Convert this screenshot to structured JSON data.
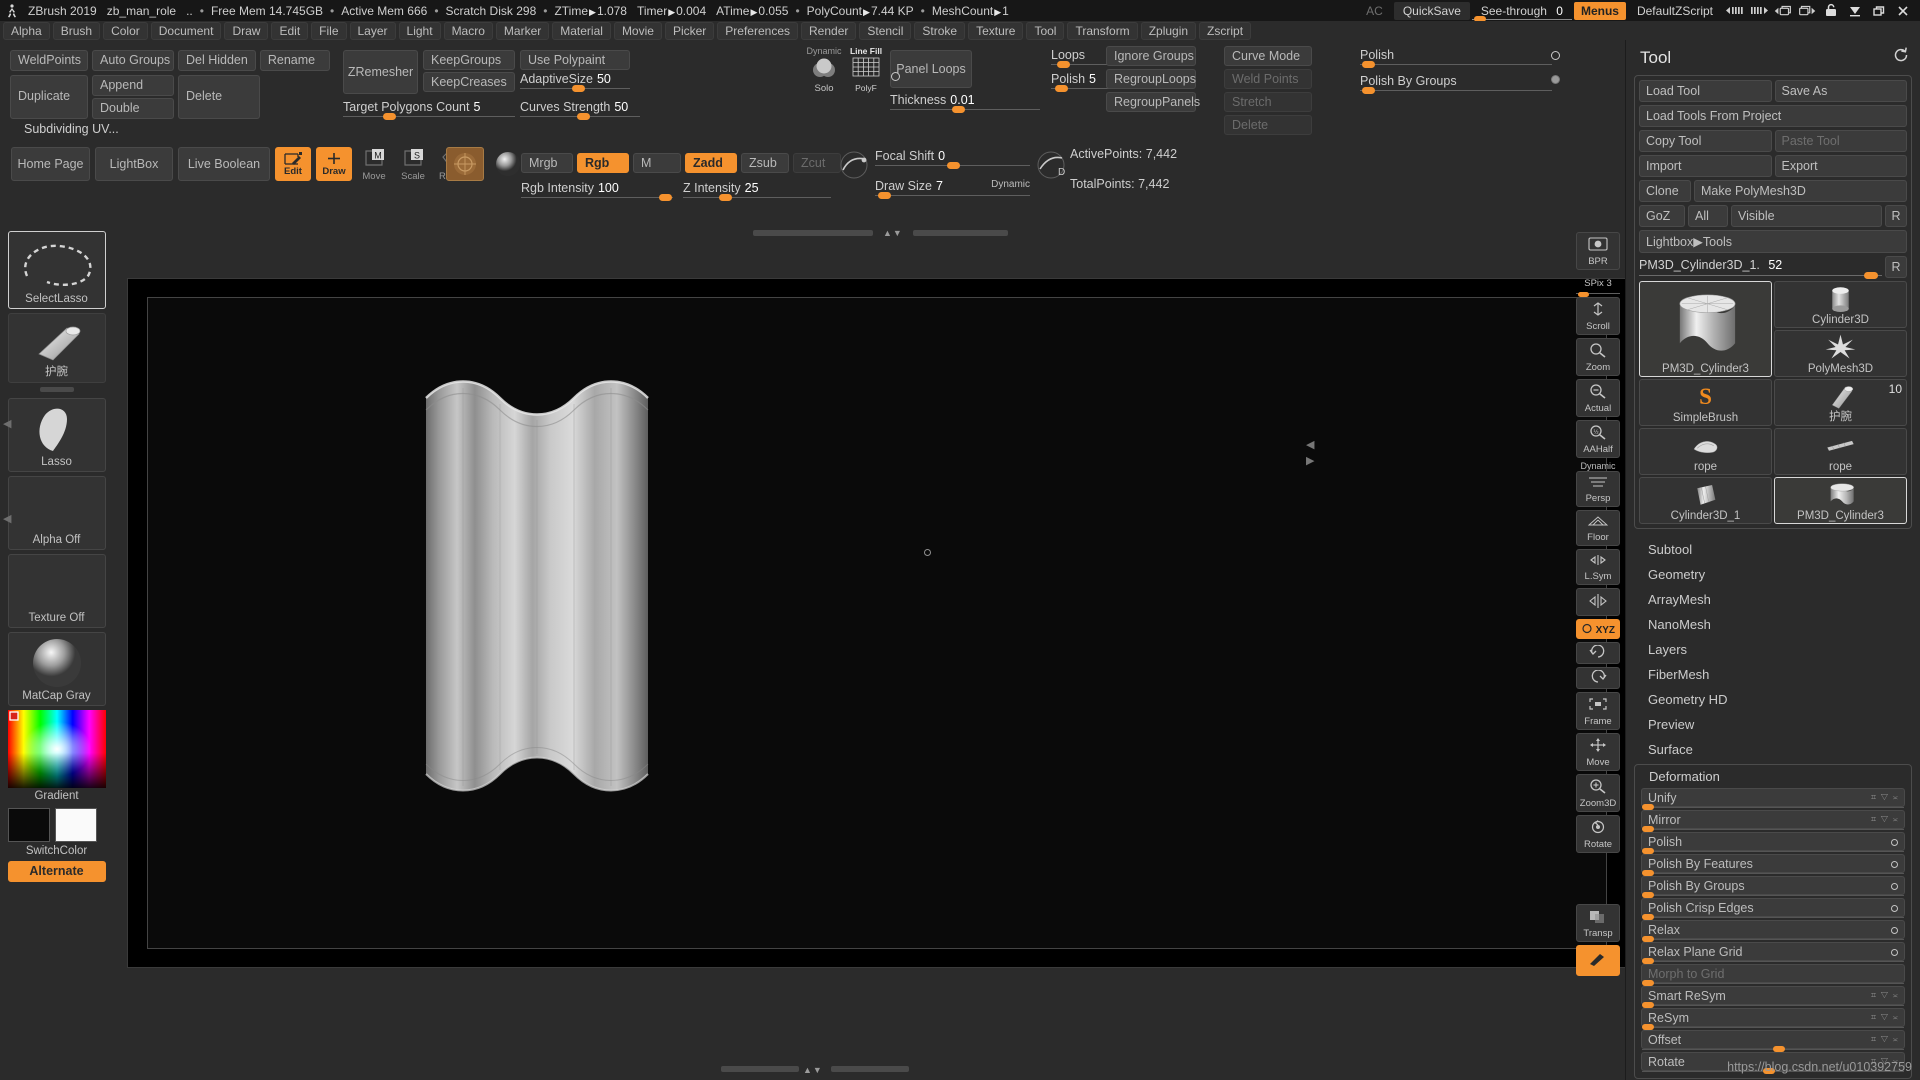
{
  "titlebar": {
    "app": "ZBrush 2019",
    "project": "zb_man_role",
    "dots": "..",
    "stats": [
      {
        "label": "Free Mem",
        "value": "14.745GB"
      },
      {
        "label": "Active Mem",
        "value": "666"
      },
      {
        "label": "Scratch Disk",
        "value": "298"
      },
      {
        "label": "ZTime",
        "value": "1.078",
        "arrow": true
      },
      {
        "label": "Timer",
        "value": "0.004",
        "arrow": true
      },
      {
        "label": "ATime",
        "value": "0.055",
        "arrow": true
      },
      {
        "label": "PolyCount",
        "value": "7.44 KP",
        "arrow": true
      },
      {
        "label": "MeshCount",
        "value": "1",
        "arrow": true
      }
    ],
    "ac": "AC",
    "quicksave": "QuickSave",
    "see_through_label": "See-through",
    "see_through_value": "0",
    "menus": "Menus",
    "zscript": "DefaultZScript",
    "icons": [
      "prev-script-icon",
      "next-script-icon",
      "prev-doc-icon",
      "next-doc-icon",
      "lock-icon",
      "minimize-icon",
      "restore-icon",
      "close-icon"
    ]
  },
  "menubar": {
    "items": [
      "Alpha",
      "Brush",
      "Color",
      "Document",
      "Draw",
      "Edit",
      "File",
      "Layer",
      "Light",
      "Macro",
      "Marker",
      "Material",
      "Movie",
      "Picker",
      "Preferences",
      "Render",
      "Stencil",
      "Stroke",
      "Texture",
      "Tool",
      "Transform",
      "Zplugin",
      "Zscript"
    ]
  },
  "shelf": {
    "geometry_buttons": [
      "WeldPoints",
      "Auto Groups",
      "Del Hidden",
      "Rename",
      "Duplicate",
      "Append",
      "Double",
      "Delete"
    ],
    "zremesher": "ZRemesher",
    "keep_groups": "KeepGroups",
    "keep_creases": "KeepCreases",
    "use_polypaint": "Use Polypaint",
    "target_polygons": {
      "label": "Target Polygons Count",
      "value": "5"
    },
    "adaptive_size": {
      "label": "AdaptiveSize",
      "value": "50"
    },
    "curves_strength": {
      "label": "Curves Strength",
      "value": "50"
    },
    "dynamic_label": "Dynamic",
    "solo_label": "Solo",
    "linefill_label": "Line Fill",
    "polyf_label": "PolyF",
    "panel_loops": "Panel Loops",
    "thickness": {
      "label": "Thickness",
      "value": "0.01"
    },
    "loops": {
      "label": "Loops",
      "value": ""
    },
    "polish": {
      "label": "Polish",
      "value": "5"
    },
    "ignore_groups": "Ignore Groups",
    "regroup_loops": "RegroupLoops",
    "regroup_panels": "RegroupPanels",
    "curve_mode": "Curve Mode",
    "weld_points": "Weld Points",
    "stretch": "Stretch",
    "delete": "Delete",
    "polish_top": {
      "label": "Polish",
      "value": ""
    },
    "polish_by_groups": {
      "label": "Polish By Groups",
      "value": ""
    },
    "status": "Subdividing UV..."
  },
  "shelf2": {
    "home_page": "Home Page",
    "lightbox": "LightBox",
    "live_boolean": "Live Boolean",
    "edit": "Edit",
    "draw": "Draw",
    "move": "Move",
    "scale": "Scale",
    "rotate": "Rotate",
    "mrgb": "Mrgb",
    "rgb": "Rgb",
    "m": "M",
    "zadd": "Zadd",
    "zsub": "Zsub",
    "zcut": "Zcut",
    "rgb_intensity": {
      "label": "Rgb Intensity",
      "value": "100"
    },
    "z_intensity": {
      "label": "Z Intensity",
      "value": "25"
    },
    "focal_shift": {
      "label": "Focal Shift",
      "value": "0"
    },
    "draw_size": {
      "label": "Draw Size",
      "value": "7"
    },
    "dynamic": "Dynamic",
    "active_points": {
      "label": "ActivePoints:",
      "value": "7,442"
    },
    "total_points": {
      "label": "TotalPoints:",
      "value": "7,442"
    }
  },
  "leftbar": {
    "cells": [
      {
        "name": "SelectLasso",
        "caption": "SelectLasso",
        "thumb": "lasso-dotted-icon",
        "selected": true
      },
      {
        "name": "current-brush",
        "caption": "护腕",
        "thumb": "brush-cone-icon",
        "selected": false
      },
      {
        "name": "Lasso",
        "caption": "Lasso",
        "thumb": "lasso-stroke-icon",
        "selected": false
      },
      {
        "name": "AlphaOff",
        "caption": "Alpha Off",
        "thumb": "empty-icon",
        "selected": false
      },
      {
        "name": "TextureOff",
        "caption": "Texture Off",
        "thumb": "empty-icon",
        "selected": false
      },
      {
        "name": "MatCapGray",
        "caption": "MatCap Gray",
        "thumb": "sphere-icon",
        "selected": false
      }
    ],
    "gradient": "Gradient",
    "switch_color": "SwitchColor",
    "alternate": "Alternate"
  },
  "navstrip": {
    "buttons": [
      {
        "label": "BPR",
        "name": "bpr-render-button",
        "active": false
      },
      {
        "label": "SPix",
        "value": "3",
        "name": "spix-slider",
        "active": false
      },
      {
        "label": "Scroll",
        "name": "scroll-button",
        "active": false
      },
      {
        "label": "Zoom",
        "name": "zoom-button",
        "active": false
      },
      {
        "label": "Actual",
        "name": "actual-size-button",
        "active": false
      },
      {
        "label": "AAHalf",
        "name": "aahalf-button",
        "active": false
      },
      {
        "label": "Persp",
        "name": "persp-button",
        "active": false,
        "head": "Dynamic"
      },
      {
        "label": "Floor",
        "name": "floor-button",
        "active": false
      },
      {
        "label": "L.Sym",
        "name": "local-symmetry-button",
        "active": false
      },
      {
        "label": "",
        "name": "sym-button",
        "active": false
      },
      {
        "label": "XYZ",
        "name": "xyz-button",
        "active": true
      },
      {
        "label": "Frame",
        "name": "frame-button",
        "active": false
      },
      {
        "label": "Move",
        "name": "move-nav-button",
        "active": false
      },
      {
        "label": "Zoom3D",
        "name": "zoom3d-button",
        "active": false
      },
      {
        "label": "Rotate",
        "name": "rotate-nav-button",
        "active": false
      },
      {
        "label": "Transp",
        "name": "transparency-button",
        "active": false
      }
    ]
  },
  "tool_panel": {
    "title": "Tool",
    "reset_icon": "reset-icon",
    "buttons": {
      "load_tool": "Load Tool",
      "save_as": "Save As",
      "load_tools_from_project": "Load Tools From Project",
      "copy_tool": "Copy Tool",
      "paste_tool": "Paste Tool",
      "import": "Import",
      "export": "Export",
      "clone": "Clone",
      "make_polymesh3d": "Make PolyMesh3D",
      "goz": "GoZ",
      "all": "All",
      "visible": "Visible",
      "r": "R",
      "lightbox_tools": "Lightbox▶Tools"
    },
    "current_tool": {
      "name": "PM3D_Cylinder3D_1.",
      "value": "52",
      "r": "R"
    },
    "thumbs": [
      {
        "caption": "PM3D_Cylinder3",
        "icon": "cylinder-scalloped-icon",
        "selected": true,
        "big": true
      },
      {
        "caption": "Cylinder3D",
        "icon": "cylinder-icon",
        "selected": false
      },
      {
        "caption": "PolyMesh3D",
        "icon": "star-icon",
        "selected": false
      },
      {
        "caption": "SimpleBrush",
        "icon": "simplebrush-s-icon",
        "selected": false
      },
      {
        "caption": "护腕",
        "icon": "cone-icon",
        "selected": false,
        "badge": "10"
      },
      {
        "caption": "rope",
        "icon": "rope-icon",
        "selected": false
      },
      {
        "caption": "rope",
        "icon": "rope2-icon",
        "selected": false
      },
      {
        "caption": "Cylinder3D_1",
        "icon": "cylinder-ribbed-icon",
        "selected": false
      },
      {
        "caption": "PM3D_Cylinder3",
        "icon": "cylinder-scalloped-icon",
        "selected": true
      }
    ],
    "subpalettes": [
      "Subtool",
      "Geometry",
      "ArrayMesh",
      "NanoMesh",
      "Layers",
      "FiberMesh",
      "Geometry HD",
      "Preview",
      "Surface"
    ],
    "deformation": {
      "title": "Deformation",
      "rows": [
        {
          "label": "Unify",
          "gizmo": "⌗ ▽ ≍",
          "knob": 0
        },
        {
          "label": "Mirror",
          "gizmo": "⌗ ▽ ≍",
          "knob": 0
        },
        {
          "label": "Polish",
          "dot": true,
          "knob": 0
        },
        {
          "label": "Polish By Features",
          "dot": true,
          "knob": 0
        },
        {
          "label": "Polish By Groups",
          "dot": true,
          "knob": 0
        },
        {
          "label": "Polish Crisp Edges",
          "dot": true,
          "knob": 0
        },
        {
          "label": "Relax",
          "dot": true,
          "knob": 0
        },
        {
          "label": "Relax Plane Grid",
          "dot": true,
          "knob": 0
        },
        {
          "label": "Morph to Grid",
          "dim": true,
          "knob": 0
        },
        {
          "label": "Smart ReSym",
          "gizmo": "⌗ ▽ ≍",
          "knob": 0
        },
        {
          "label": "ReSym",
          "gizmo": "⌗ ▽ ≍",
          "knob": 0
        },
        {
          "label": "Offset",
          "gizmo": "⌗ ▽ ≍",
          "knob": 55
        },
        {
          "label": "Rotate",
          "gizmo": "⌗ ▽ ≍",
          "knob": 50
        }
      ]
    }
  },
  "watermark": "https://blog.csdn.net/u010392759"
}
